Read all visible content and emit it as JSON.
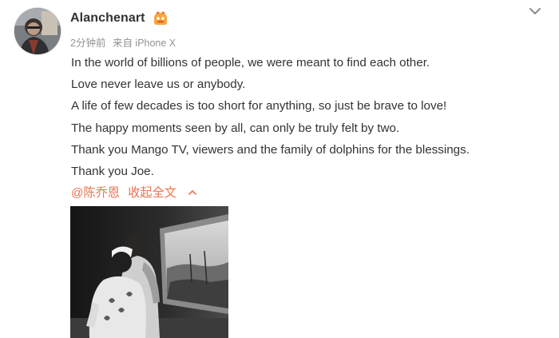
{
  "post": {
    "username": "Alanchenart",
    "time": "2分钟前",
    "source": "来自 iPhone X",
    "lines": [
      "In the world of billions of people, we were meant to find each other.",
      "Love never leave us or anybody.",
      "A life of few decades is too short for anything, so just be brave to love!",
      "The happy moments seen by all, can only be truly felt by two.",
      "Thank you Mango TV, viewers and the family of dolphins for the blessings.",
      "Thank you Joe."
    ],
    "mention": "@陈乔恩",
    "collapse_label": "收起全文"
  },
  "icons": {
    "avatar": "user-avatar",
    "badge": "vip-badge-icon",
    "menu": "chevron-down-icon",
    "collapse": "chevron-up-icon"
  },
  "colors": {
    "accent": "#eb7350",
    "text": "#333333",
    "meta": "#939393"
  }
}
